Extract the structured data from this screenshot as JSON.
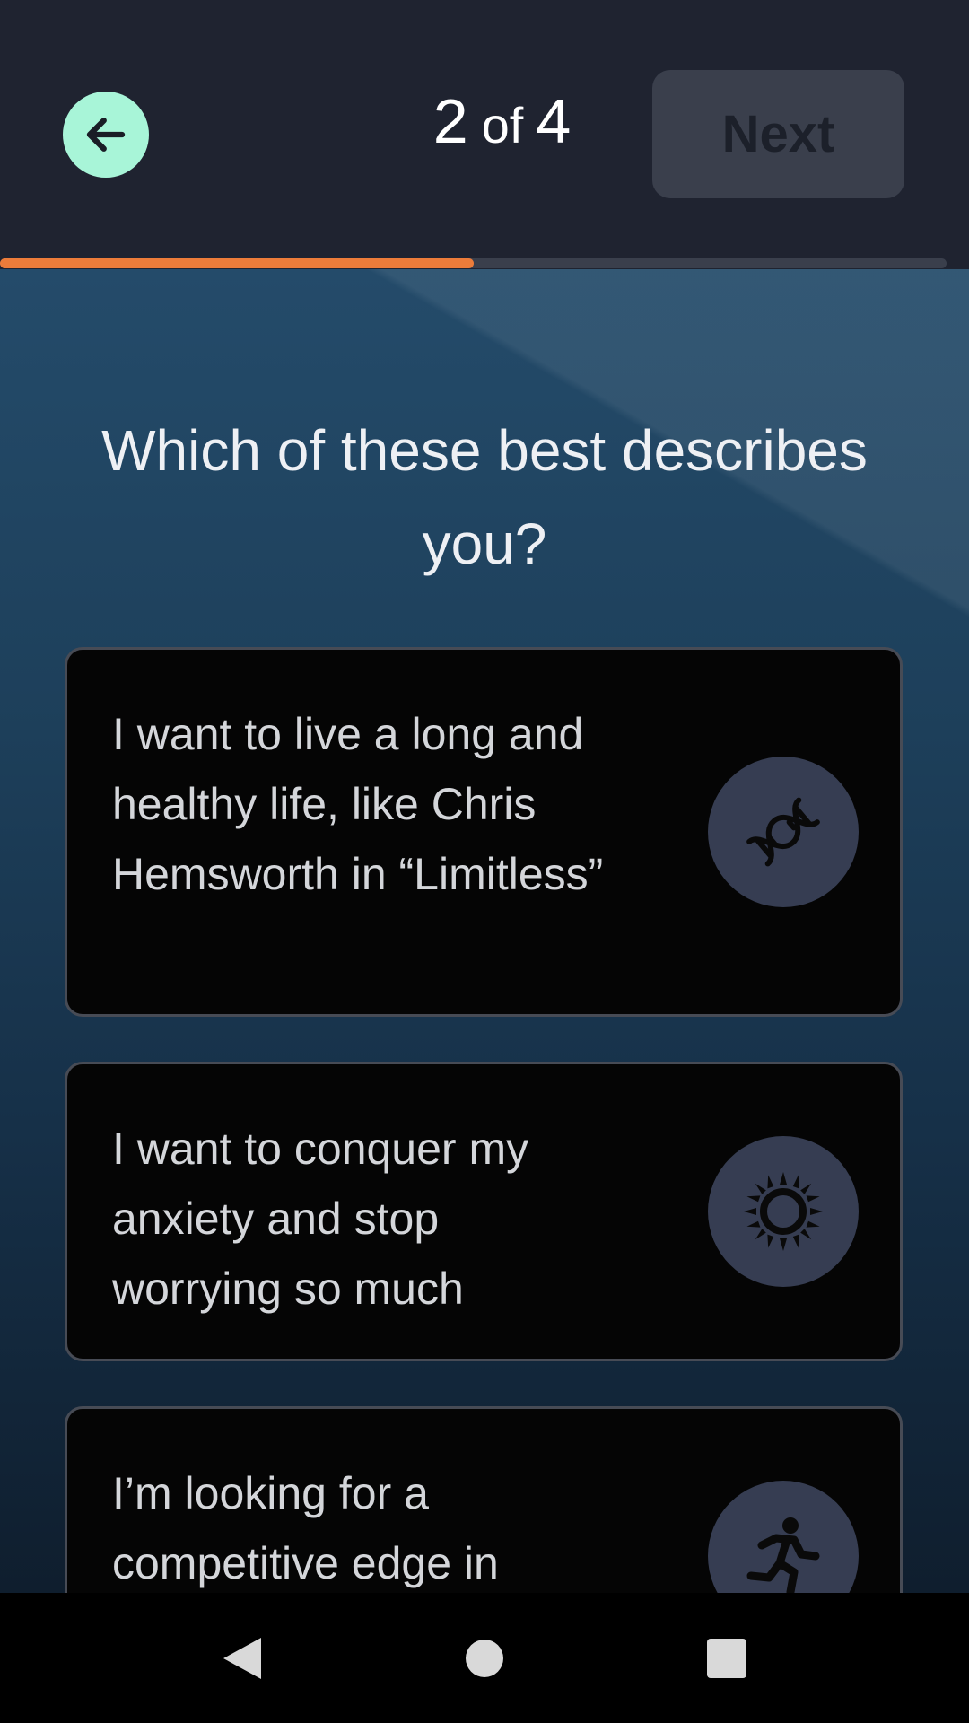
{
  "header": {
    "back_icon": "arrow-left-icon",
    "step_current": "2",
    "step_of": "of",
    "step_total": "4",
    "next_label": "Next",
    "progress_fraction": 0.5,
    "progress_color": "#ec7c3a",
    "back_button_color": "#a8f5d8"
  },
  "main": {
    "question": "Which of these best describes you?",
    "options": [
      {
        "text": "I want to live a long and healthy life, like Chris Hemsworth in “Limitless”",
        "icon": "dna-icon"
      },
      {
        "text": "I want to conquer my anxiety and stop worrying so much",
        "icon": "sun-icon"
      },
      {
        "text": "I’m looking for a competitive edge in",
        "icon": "running-person-icon"
      }
    ]
  },
  "navbar": {
    "back_icon": "nav-back-triangle-icon",
    "home_icon": "nav-home-circle-icon",
    "recent_icon": "nav-recents-square-icon"
  }
}
